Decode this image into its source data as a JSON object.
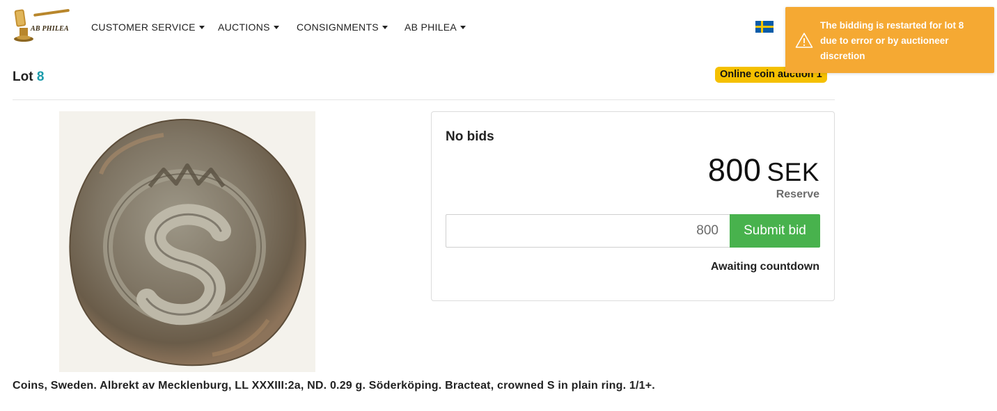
{
  "header": {
    "logo_text": "AB PHILEA",
    "nav": [
      {
        "label": "CUSTOMER SERVICE"
      },
      {
        "label": "AUCTIONS"
      },
      {
        "label": "CONSIGNMENTS"
      },
      {
        "label": "AB PHILEA"
      }
    ],
    "icons": [
      "sweden-flag-icon",
      "search-icon",
      "cart-icon"
    ]
  },
  "toast": {
    "message": "The bidding is restarted for lot 8 due to error or by auctioneer discretion",
    "icon": "warning-icon",
    "color": "#f5a933"
  },
  "lot": {
    "label": "Lot",
    "number": "8",
    "auction_badge": "Online coin auction 1",
    "description": "Coins, Sweden. Albrekt av Mecklenburg, LL XXXIII:2a, ND. 0.29 g. Söderköping. Bracteat, crowned S in plain ring. 1/1+."
  },
  "bid_panel": {
    "status": "No bids",
    "amount": "800",
    "currency": "SEK",
    "amount_caption": "Reserve",
    "input_placeholder": "800",
    "submit_label": "Submit bid",
    "countdown_text": "Awaiting countdown"
  },
  "colors": {
    "accent_teal": "#1a9bab",
    "badge_yellow": "#f5c000",
    "submit_green": "#48b24d",
    "search_orange": "#e08a00"
  }
}
